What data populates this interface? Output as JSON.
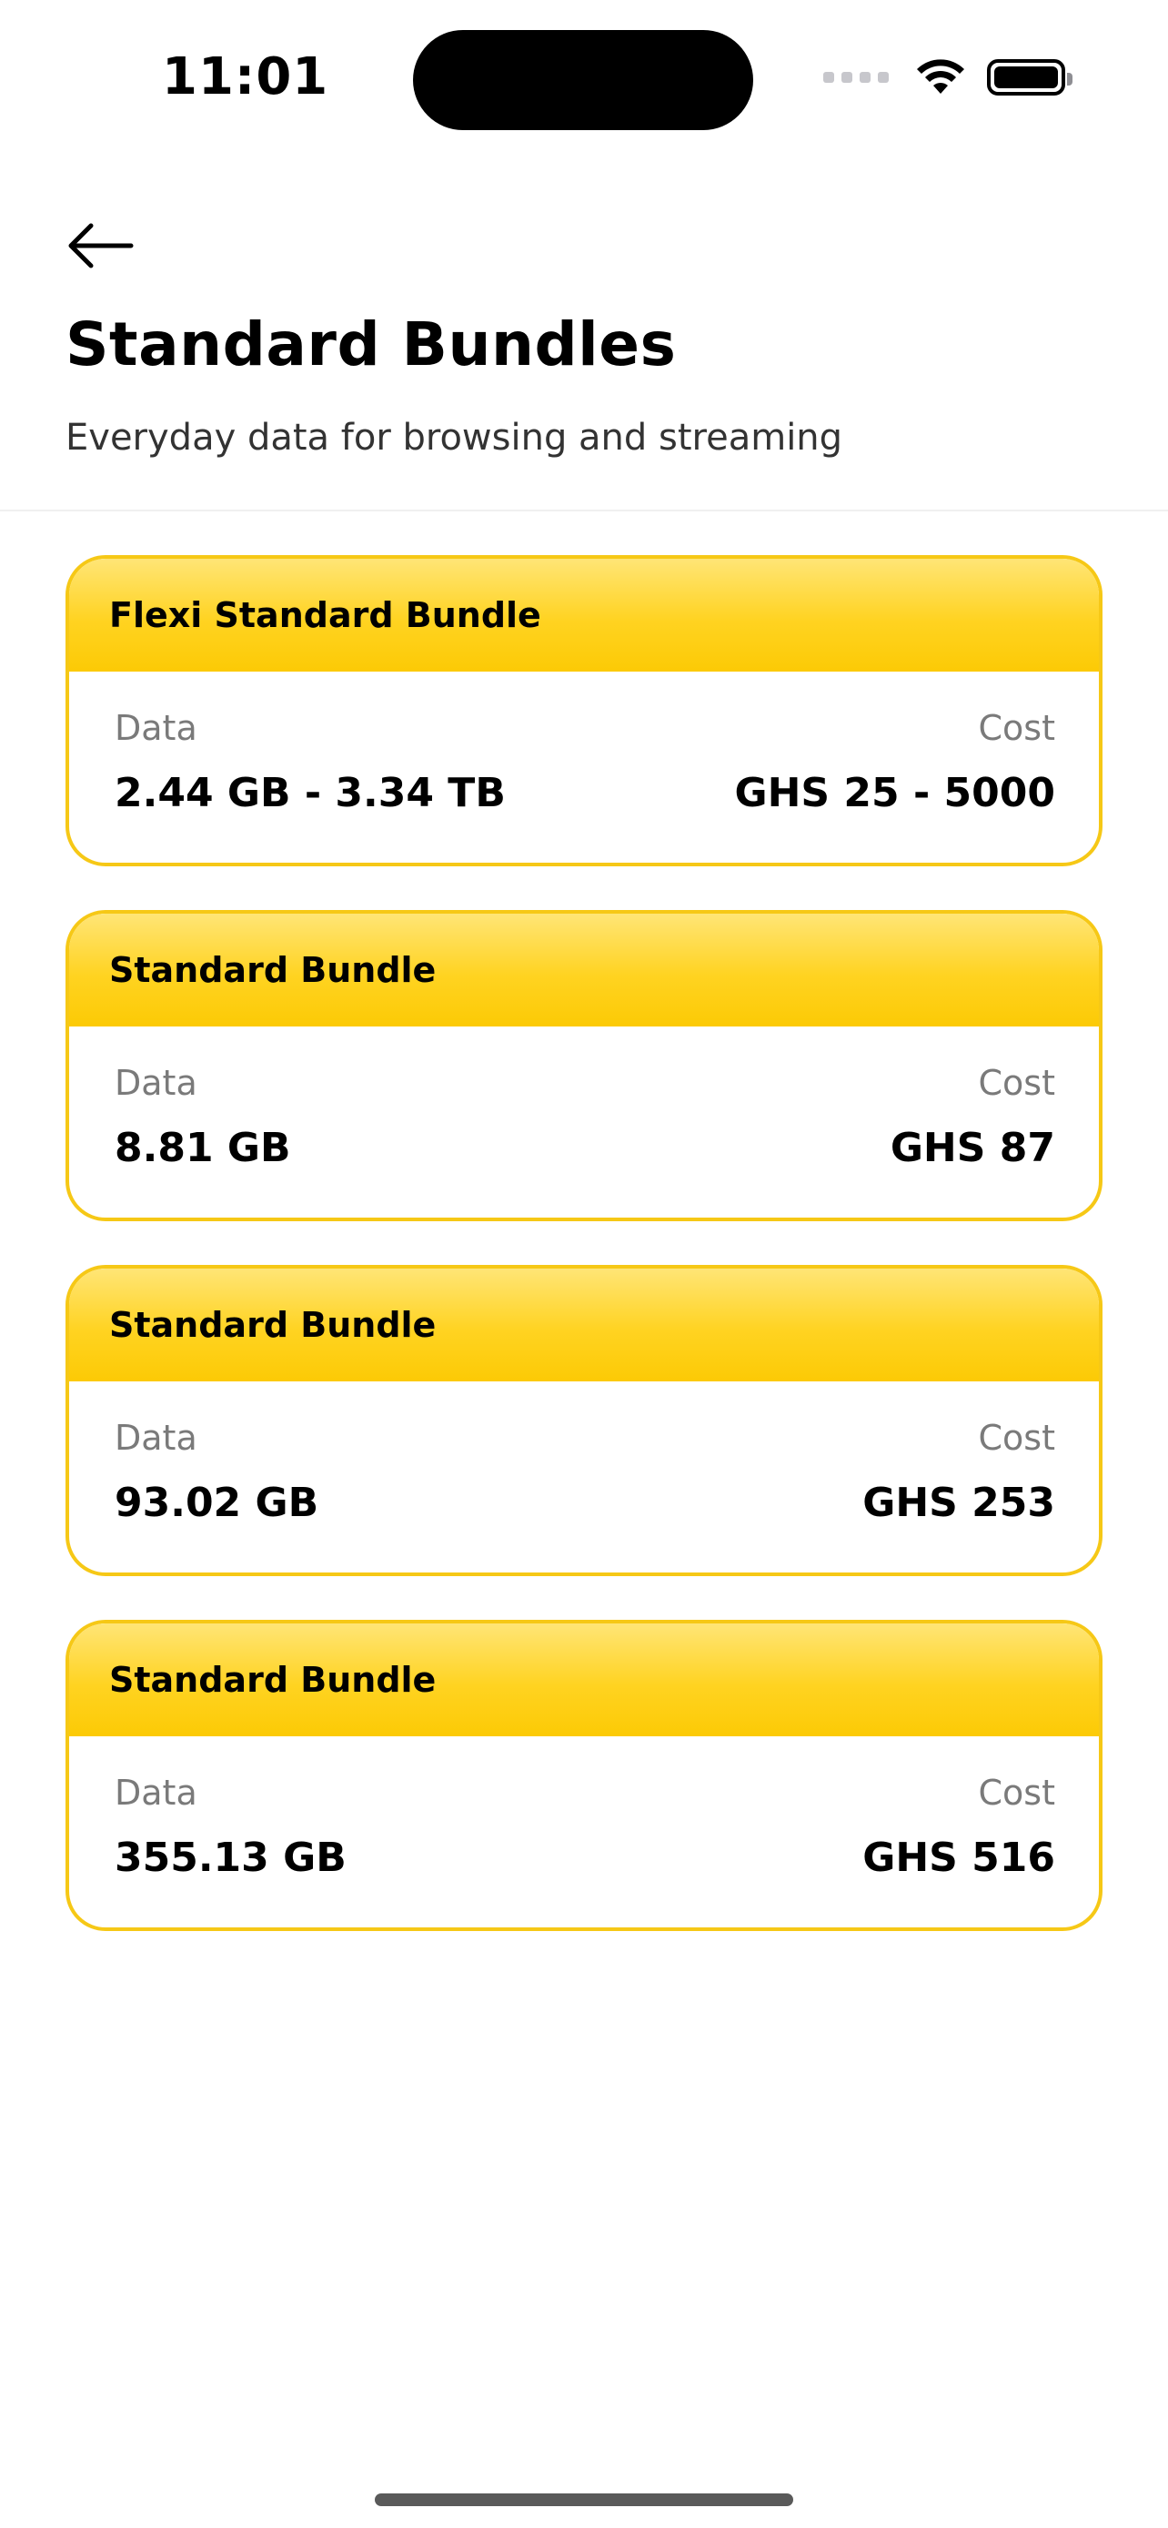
{
  "status_bar": {
    "time": "11:01"
  },
  "header": {
    "title": "Standard Bundles",
    "subtitle": "Everyday data for browsing and streaming"
  },
  "bundles": [
    {
      "name": "Flexi Standard Bundle",
      "data_label": "Data",
      "data_value": "2.44 GB - 3.34 TB",
      "cost_label": "Cost",
      "cost_value": "GHS 25 - 5000"
    },
    {
      "name": "Standard Bundle",
      "data_label": "Data",
      "data_value": "8.81 GB",
      "cost_label": "Cost",
      "cost_value": "GHS 87"
    },
    {
      "name": "Standard Bundle",
      "data_label": "Data",
      "data_value": "93.02 GB",
      "cost_label": "Cost",
      "cost_value": "GHS 253"
    },
    {
      "name": "Standard Bundle",
      "data_label": "Data",
      "data_value": "355.13 GB",
      "cost_label": "Cost",
      "cost_value": "GHS 516"
    }
  ],
  "colors": {
    "accent_yellow": "#FFCC00",
    "card_border": "#F6C816",
    "label_gray": "#7A7A7A"
  },
  "icons": {
    "back": "arrow-left-icon",
    "wifi": "wifi-icon",
    "battery": "battery-icon",
    "signal": "cellular-signal-icon"
  }
}
